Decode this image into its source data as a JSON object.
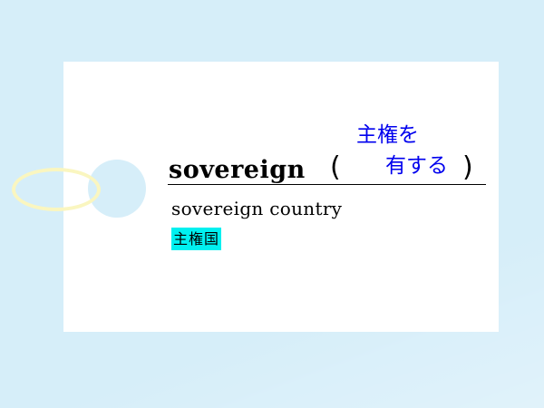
{
  "card": {
    "headword": "sovereign",
    "paren_open": "(",
    "paren_close": ")",
    "meaning_line1": "主権を",
    "meaning_line2": "有する",
    "phrase": "sovereign country",
    "phrase_translation": "主権国"
  },
  "colors": {
    "background": "#d6eef9",
    "card": "#ffffff",
    "meaning_text": "#0000ee",
    "highlight": "#00f0f0",
    "ring": "#faf6c0"
  }
}
